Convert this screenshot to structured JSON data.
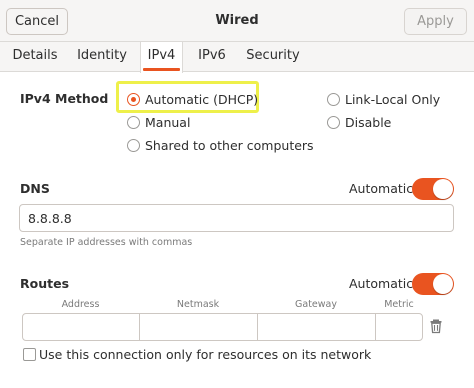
{
  "window": {
    "title": "Wired"
  },
  "header": {
    "cancel_label": "Cancel",
    "apply_label": "Apply"
  },
  "tabs": [
    {
      "label": "Details"
    },
    {
      "label": "Identity"
    },
    {
      "label": "IPv4",
      "active": true
    },
    {
      "label": "IPv6"
    },
    {
      "label": "Security"
    }
  ],
  "ipv4": {
    "method_label": "IPv4 Method",
    "options": [
      {
        "label": "Automatic (DHCP)",
        "checked": true
      },
      {
        "label": "Link-Local Only",
        "checked": false
      },
      {
        "label": "Manual",
        "checked": false
      },
      {
        "label": "Disable",
        "checked": false
      },
      {
        "label": "Shared to other computers",
        "checked": false
      }
    ]
  },
  "dns": {
    "label": "DNS",
    "automatic_label": "Automatic",
    "automatic_on": true,
    "value": "8.8.8.8",
    "hint": "Separate IP addresses with commas"
  },
  "routes": {
    "label": "Routes",
    "automatic_label": "Automatic",
    "automatic_on": true,
    "columns": [
      "Address",
      "Netmask",
      "Gateway",
      "Metric"
    ]
  },
  "only_local": {
    "label": "Use this connection only for resources on its network",
    "checked": false
  },
  "colors": {
    "accent": "#e95420",
    "highlight": "#eef04a"
  }
}
